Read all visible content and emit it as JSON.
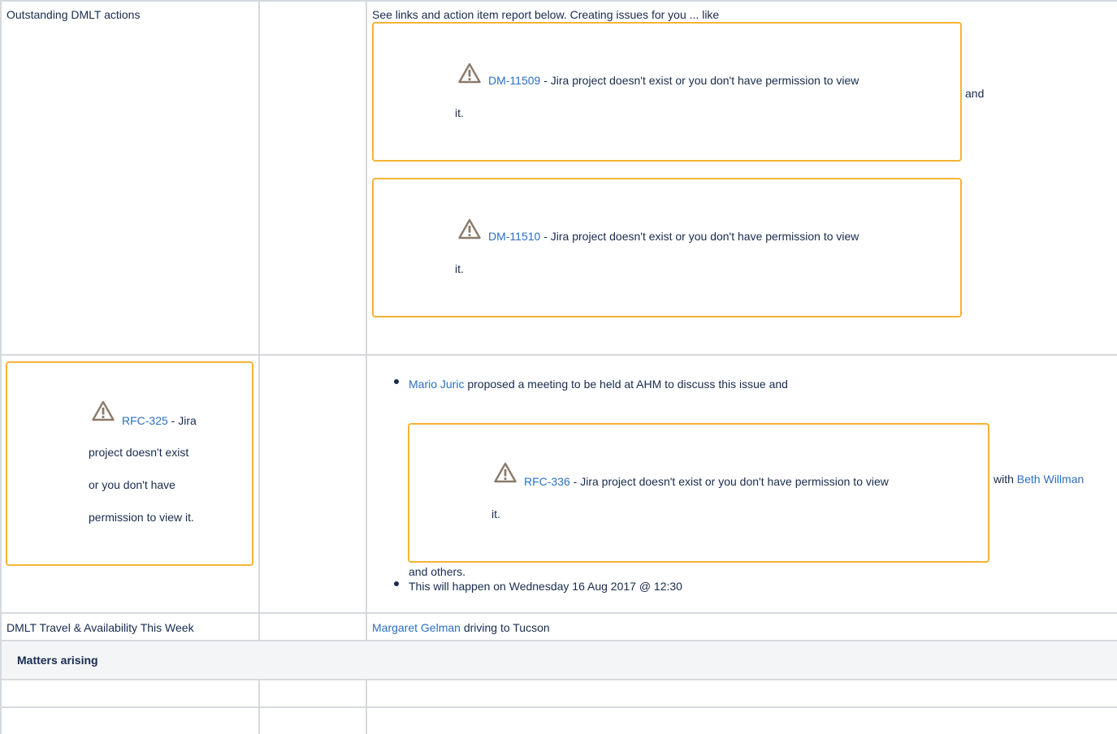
{
  "rows": {
    "outstanding": {
      "label": "Outstanding DMLT actions",
      "intro": "See links and action item report below.  Creating issues for you ... like",
      "issues": [
        {
          "key": "DM-11509",
          "msg_line1": " - Jira project doesn't exist or you don't have permission to view",
          "msg_line2": "it."
        },
        {
          "key": "DM-11510",
          "msg_line1": " - Jira project doesn't exist or you don't have permission to view",
          "msg_line2": "it."
        }
      ],
      "and_text": "and"
    },
    "rfc": {
      "left_issue": {
        "key": "RFC-325",
        "msg": [
          " - Jira",
          "project doesn't exist",
          "or you don't have",
          "permission to view it."
        ]
      },
      "bullet1": {
        "user": "Mario Juric",
        "text": " proposed a meeting to be held at AHM to discuss this issue and",
        "issue_key": "RFC-336",
        "issue_msg_line1": " - Jira project doesn't exist or you don't have permission to view",
        "issue_msg_line2": "it.",
        "with_text": "with ",
        "with_user": "Beth Willman",
        "tail": "and others."
      },
      "bullet2": "This will happen on  Wednesday 16 Aug 2017 @ 12:30"
    },
    "travel": {
      "label": "DMLT Travel & Availability This Week",
      "user": "Margaret Gelman",
      "text": " driving to Tucson"
    },
    "matters": {
      "heading": "Matters arising"
    }
  },
  "icons": {
    "warning": "warning-triangle-icon",
    "bullet": "bullet-dot"
  },
  "colors": {
    "link": "#2a6fc4",
    "box_border": "#f5b335",
    "grid": "#d5d9de",
    "header_bg": "#f4f5f7",
    "warning_icon": "#8b7a6a"
  }
}
